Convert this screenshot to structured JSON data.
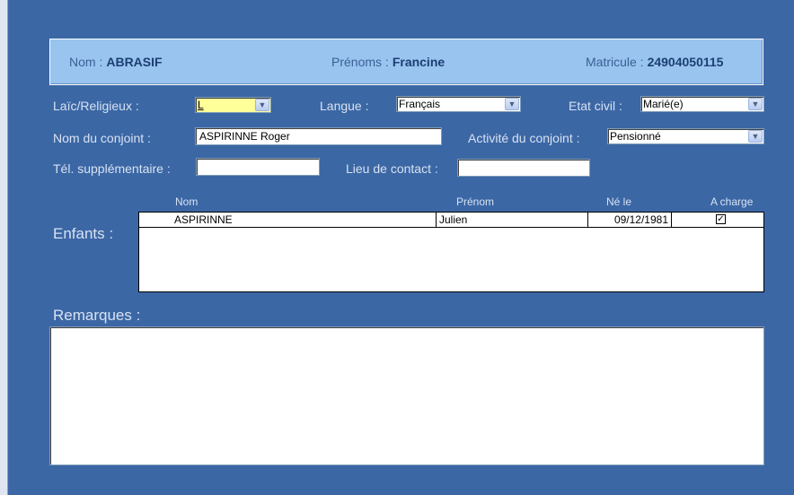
{
  "header": {
    "nom_label": "Nom :",
    "nom_value": "ABRASIF",
    "prenoms_label": "Prénoms :",
    "prenoms_value": "Francine",
    "matricule_label": "Matricule :",
    "matricule_value": "24904050115"
  },
  "fields": {
    "laic_label": "Laïc/Religieux :",
    "laic_value": "L",
    "langue_label": "Langue :",
    "langue_value": "Français",
    "etat_civil_label": "Etat civil :",
    "etat_civil_value": "Marié(e)",
    "conjoint_label": "Nom du conjoint :",
    "conjoint_value": "ASPIRINNE Roger",
    "activite_label": "Activité du conjoint :",
    "activite_value": "Pensionné",
    "tel_label": "Tél. supplémentaire :",
    "tel_value": "",
    "lieu_label": "Lieu de contact :",
    "lieu_value": ""
  },
  "enfants": {
    "label": "Enfants :",
    "columns": {
      "nom": "Nom",
      "prenom": "Prénom",
      "ne_le": "Né le",
      "a_charge": "A charge"
    },
    "rows": [
      {
        "nom": "ASPIRINNE",
        "prenom": "Julien",
        "ne_le": "09/12/1981",
        "a_charge": "✓"
      }
    ]
  },
  "remarques": {
    "label": "Remarques :",
    "value": ""
  },
  "icons": {
    "dropdown": "chevron-down-icon",
    "check": "checkmark-icon"
  },
  "colors": {
    "background": "#3c67a5",
    "header": "#98c4ef",
    "highlight": "#ffff99"
  }
}
